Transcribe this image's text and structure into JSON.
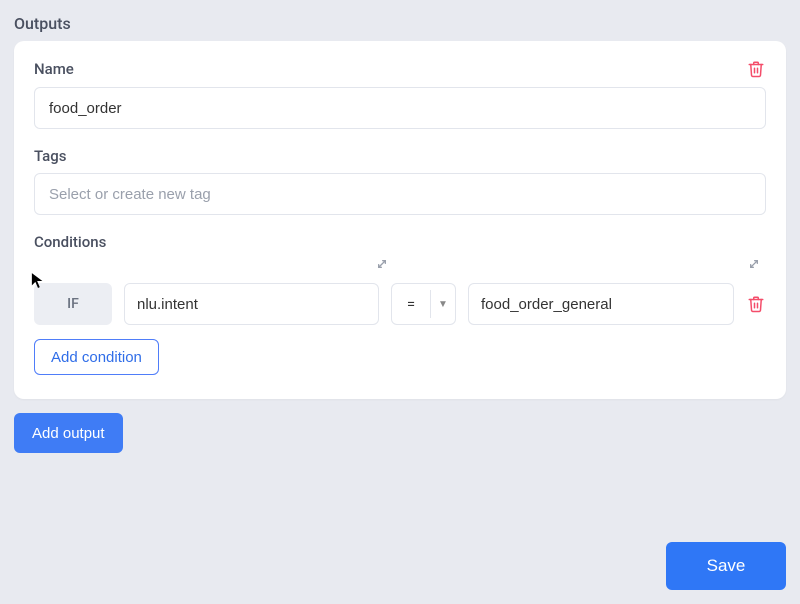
{
  "section_title": "Outputs",
  "output": {
    "name_label": "Name",
    "name_value": "food_order",
    "tags_label": "Tags",
    "tags_placeholder": "Select or create new tag",
    "conditions_label": "Conditions",
    "condition": {
      "if_label": "IF",
      "lhs": "nlu.intent",
      "operator": "=",
      "rhs": "food_order_general"
    },
    "add_condition_label": "Add condition"
  },
  "add_output_label": "Add output",
  "save_label": "Save"
}
